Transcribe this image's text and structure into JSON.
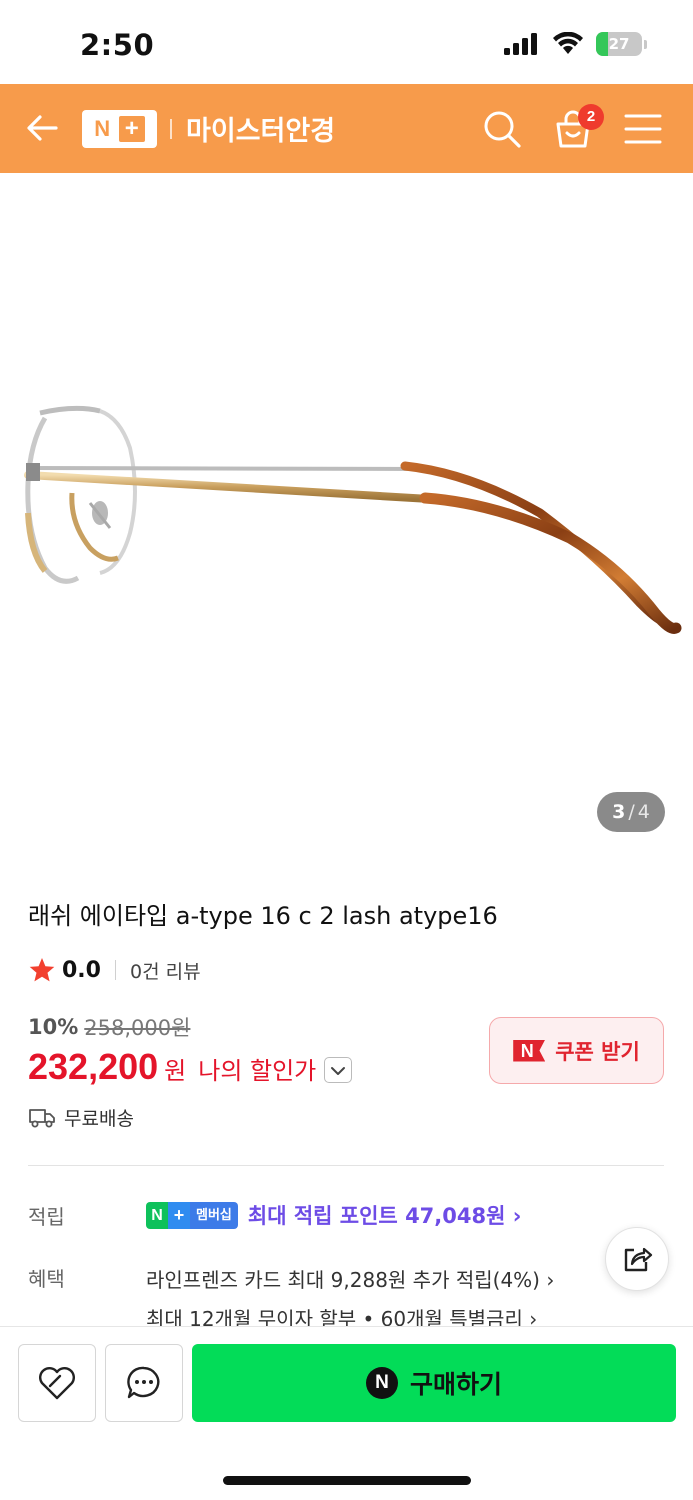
{
  "status_bar": {
    "time": "2:50",
    "battery_level": "27",
    "battery_color": "#34c759"
  },
  "header": {
    "logo_n": "N",
    "logo_plus": "+",
    "store_name": "마이스터안경",
    "cart_count": "2",
    "bg_color": "#f79b4b",
    "icons": [
      "back-arrow-icon",
      "search-icon",
      "shopping-bag-icon",
      "hamburger-menu-icon"
    ]
  },
  "gallery": {
    "current": "3",
    "separator": "/",
    "total": "4"
  },
  "product": {
    "title": "래쉬 에이타입 a-type 16 c 2 lash atype16",
    "rating": "0.0",
    "review_count": "0건 리뷰"
  },
  "price": {
    "discount_rate": "10%",
    "original_price": "258,000원",
    "final_price": "232,200",
    "currency": "원",
    "my_discount_label": "나의 할인가",
    "accent_color": "#e4142a"
  },
  "coupon": {
    "badge": "N",
    "label": "쿠폰 받기"
  },
  "shipping": {
    "label": "무료배송"
  },
  "points": {
    "label": "적립",
    "badge_n": "N",
    "badge_plus": "+",
    "badge_text": "멤버십",
    "text": "최대 적립 포인트 47,048원 ›"
  },
  "benefits": {
    "label": "혜택",
    "line1": "라인프렌즈 카드 최대 9,288원 추가 적립(4%) ›",
    "line2": "최대 12개월 무이자 할부 • 60개월 특별금리 ›"
  },
  "bottom_bar": {
    "buy_badge": "N",
    "buy_label": "구매하기",
    "buy_color": "#03dc58"
  }
}
